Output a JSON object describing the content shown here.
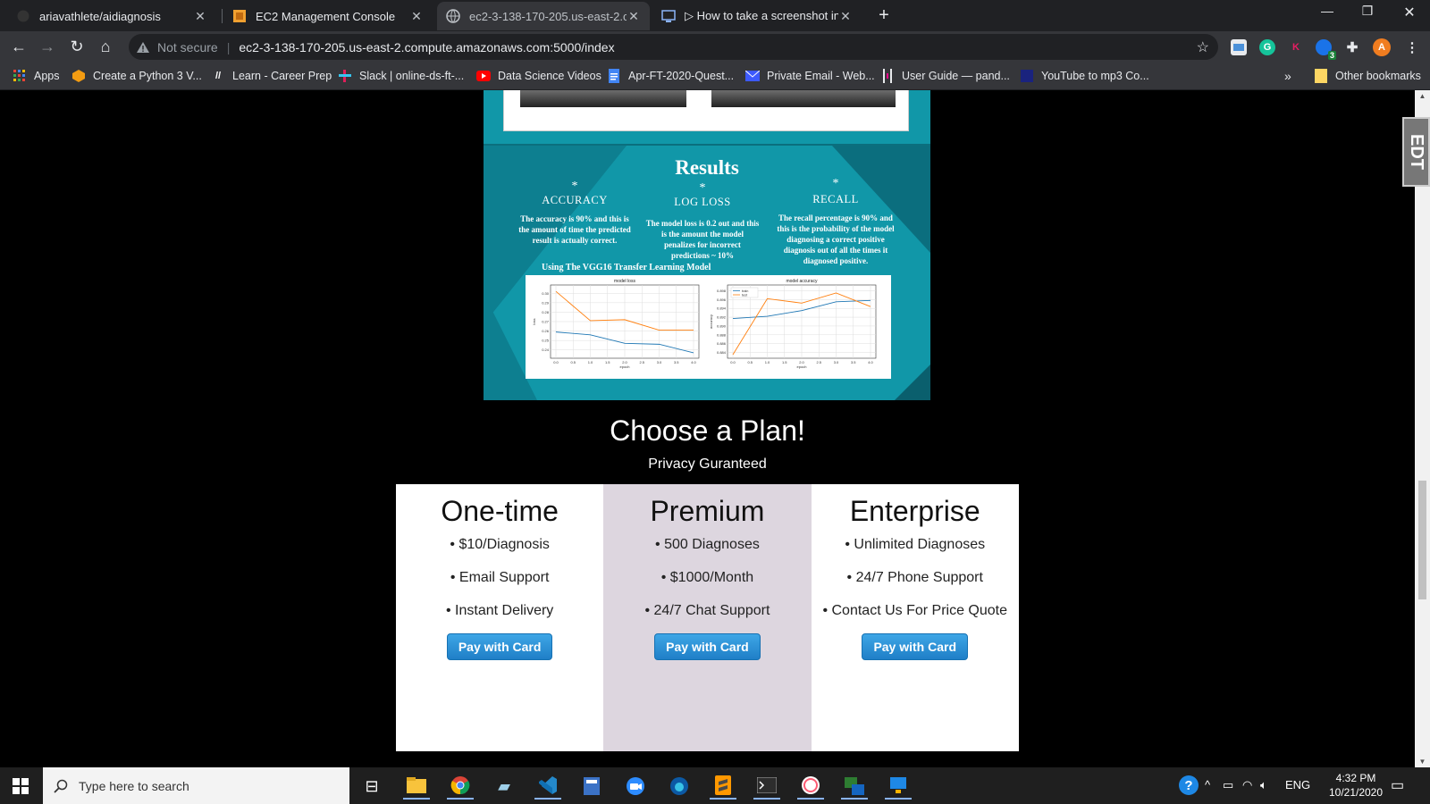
{
  "browser": {
    "tabs": [
      {
        "title": "ariavathlete/aidiagnosis",
        "icon": "github-icon"
      },
      {
        "title": "EC2 Management Console",
        "icon": "aws-icon"
      },
      {
        "title": "ec2-3-138-170-205.us-east-2.con",
        "icon": "globe-icon"
      },
      {
        "title": "▷ How to take a screenshot in W",
        "icon": "video-icon"
      }
    ],
    "address": {
      "security": "Not secure",
      "url": "ec2-3-138-170-205.us-east-2.compute.amazonaws.com:5000/index"
    },
    "bookmarks": [
      {
        "label": "Apps",
        "icon": "apps-grid-icon"
      },
      {
        "label": "Create a Python 3 V...",
        "icon": "cube-icon"
      },
      {
        "label": "Learn - Career Prep",
        "icon": "slash-logo-icon"
      },
      {
        "label": "Slack | online-ds-ft-...",
        "icon": "slack-icon"
      },
      {
        "label": "Data Science Videos",
        "icon": "youtube-icon"
      },
      {
        "label": "Apr-FT-2020-Quest...",
        "icon": "doc-icon"
      },
      {
        "label": "Private Email - Web...",
        "icon": "mail-icon"
      },
      {
        "label": "User Guide — pand...",
        "icon": "pandas-icon"
      },
      {
        "label": "YouTube to mp3 Co...",
        "icon": "music-icon"
      }
    ],
    "bookmarks_more": "»",
    "other_bookmarks": "Other bookmarks",
    "extension_badge": "3",
    "profile_initial": "A"
  },
  "results": {
    "title": "Results",
    "metrics": [
      {
        "star": "*",
        "name": "ACCURACY",
        "desc": "The accuracy is 90% and this is the amount of time the predicted result is actually correct."
      },
      {
        "star": "*",
        "name": "LOG LOSS",
        "desc": "The model loss is 0.2 out and this is the amount the model penalizes for incorrect predictions ~ 10%"
      },
      {
        "star": "*",
        "name": "RECALL",
        "desc": "The recall percentage is  90% and this is the probability of the model diagnosing a correct positive diagnosis out of all the times it diagnosed positive."
      }
    ],
    "model_label": "Using The VGG16 Transfer Learning Model"
  },
  "chart_data": [
    {
      "type": "line",
      "title": "model loss",
      "xlabel": "epoch",
      "ylabel": "loss",
      "x": [
        0,
        1,
        2,
        3,
        4
      ],
      "xticks": [
        "0.0",
        "0.5",
        "1.0",
        "1.5",
        "2.0",
        "2.5",
        "3.0",
        "3.5",
        "4.0"
      ],
      "yticks": [
        "0.24",
        "0.25",
        "0.26",
        "0.27",
        "0.28",
        "0.29",
        "0.30"
      ],
      "ylim": [
        0.235,
        0.305
      ],
      "series": [
        {
          "values": [
            0.259,
            0.256,
            0.247,
            0.246,
            0.237
          ],
          "color": "#1f77b4"
        },
        {
          "values": [
            0.302,
            0.271,
            0.272,
            0.261,
            0.261
          ],
          "color": "#ff7f0e"
        }
      ],
      "grid": true
    },
    {
      "type": "line",
      "title": "model accuracy",
      "xlabel": "epoch",
      "ylabel": "accuracy",
      "x": [
        0,
        1,
        2,
        3,
        4
      ],
      "xticks": [
        "0.0",
        "0.5",
        "1.0",
        "1.5",
        "2.0",
        "2.5",
        "3.0",
        "3.5",
        "4.0"
      ],
      "yticks": [
        "0.884",
        "0.886",
        "0.888",
        "0.890",
        "0.892",
        "0.894",
        "0.896",
        "0.898"
      ],
      "ylim": [
        0.8835,
        0.8985
      ],
      "series": [
        {
          "name": "train",
          "values": [
            0.8917,
            0.8922,
            0.8935,
            0.8955,
            0.8958
          ],
          "color": "#1f77b4"
        },
        {
          "name": "test",
          "values": [
            0.8835,
            0.8962,
            0.8952,
            0.8975,
            0.8944
          ],
          "color": "#ff7f0e"
        }
      ],
      "legend": "top-left",
      "grid": true
    }
  ],
  "plans": {
    "title": "Choose a Plan!",
    "subtitle": "Privacy Guranteed",
    "items": [
      {
        "name": "One-time",
        "features": [
          "• $10/Diagnosis",
          "• Email Support",
          "• Instant Delivery"
        ],
        "button": "Pay with Card"
      },
      {
        "name": "Premium",
        "features": [
          "• 500 Diagnoses",
          "• $1000/Month",
          "• 24/7 Chat Support"
        ],
        "button": "Pay with Card"
      },
      {
        "name": "Enterprise",
        "features": [
          "• Unlimited Diagnoses",
          "• 24/7 Phone Support",
          "• Contact Us For Price Quote"
        ],
        "button": "Pay with Card"
      }
    ]
  },
  "overlay_label": "EDT",
  "taskbar": {
    "search_placeholder": "Type here to search",
    "language": "ENG",
    "time": "4:32 PM",
    "date": "10/21/2020"
  },
  "colors": {
    "teal": "#1197a8",
    "premium_bg": "#ddd6df",
    "button_blue": "#1f7fc7"
  }
}
